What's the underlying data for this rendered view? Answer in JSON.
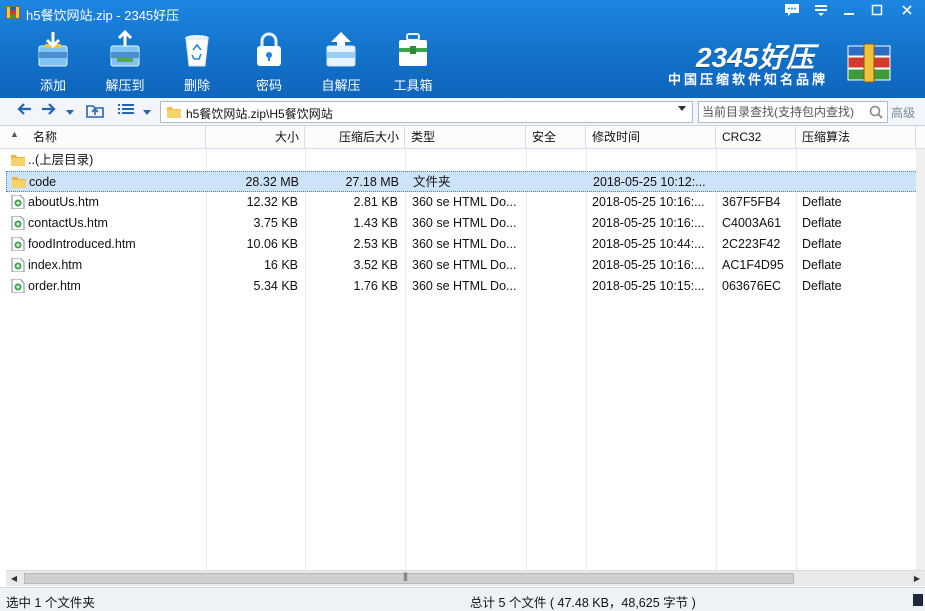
{
  "window": {
    "title": "h5餐饮网站.zip - 2345好压"
  },
  "toolbar": {
    "add": "添加",
    "extract_to": "解压到",
    "delete": "删除",
    "password": "密码",
    "self_extract": "自解压",
    "toolbox": "工具箱"
  },
  "brand": {
    "logo": "2345好压",
    "slogan": "中国压缩软件知名品牌"
  },
  "address": {
    "path": "h5餐饮网站.zip\\H5餐饮网站",
    "search_placeholder": "当前目录查找(支持包内查找)",
    "advanced": "高级"
  },
  "columns": {
    "name": "名称",
    "size": "大小",
    "packed": "压缩后大小",
    "type": "类型",
    "security": "安全",
    "modified": "修改时间",
    "crc": "CRC32",
    "method": "压缩算法"
  },
  "files": [
    {
      "name": "..(上层目录)",
      "icon": "folder-icon",
      "size": "",
      "packed": "",
      "type": "",
      "security": "",
      "modified": "",
      "crc": "",
      "method": ""
    },
    {
      "name": "code",
      "icon": "folder-icon",
      "size": "28.32 MB",
      "packed": "27.18 MB",
      "type": "文件夹",
      "security": "",
      "modified": "2018-05-25 10:12:...",
      "crc": "",
      "method": ""
    },
    {
      "name": "aboutUs.htm",
      "icon": "html-file-icon",
      "size": "12.32 KB",
      "packed": "2.81 KB",
      "type": "360 se HTML Do...",
      "security": "",
      "modified": "2018-05-25 10:16:...",
      "crc": "367F5FB4",
      "method": "Deflate"
    },
    {
      "name": "contactUs.htm",
      "icon": "html-file-icon",
      "size": "3.75 KB",
      "packed": "1.43 KB",
      "type": "360 se HTML Do...",
      "security": "",
      "modified": "2018-05-25 10:16:...",
      "crc": "C4003A61",
      "method": "Deflate"
    },
    {
      "name": "foodIntroduced.htm",
      "icon": "html-file-icon",
      "size": "10.06 KB",
      "packed": "2.53 KB",
      "type": "360 se HTML Do...",
      "security": "",
      "modified": "2018-05-25 10:44:...",
      "crc": "2C223F42",
      "method": "Deflate"
    },
    {
      "name": "index.htm",
      "icon": "html-file-icon",
      "size": "16 KB",
      "packed": "3.52 KB",
      "type": "360 se HTML Do...",
      "security": "",
      "modified": "2018-05-25 10:16:...",
      "crc": "AC1F4D95",
      "method": "Deflate"
    },
    {
      "name": "order.htm",
      "icon": "html-file-icon",
      "size": "5.34 KB",
      "packed": "1.76 KB",
      "type": "360 se HTML Do...",
      "security": "",
      "modified": "2018-05-25 10:15:...",
      "crc": "063676EC",
      "method": "Deflate"
    }
  ],
  "selected_row": 1,
  "status": {
    "left": "选中 1 个文件夹",
    "center": "总计 5 个文件 ( 47.48 KB，48,625 字节 )"
  },
  "colors": {
    "titlebar": "#1d86e0",
    "selection": "#cde3f7",
    "accent": "#2464b4"
  }
}
